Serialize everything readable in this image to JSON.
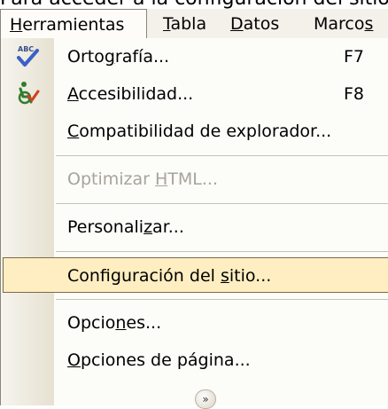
{
  "caption": "Para acceder a la configuración del sitio",
  "menubar": {
    "items": [
      {
        "pre": "",
        "u": "H",
        "post": "erramientas"
      },
      {
        "pre": "",
        "u": "T",
        "post": "abla"
      },
      {
        "pre": "",
        "u": "D",
        "post": "atos"
      },
      {
        "pre": "Marco",
        "u": "s",
        "post": ""
      }
    ]
  },
  "menu": {
    "ortografia": {
      "pre": "Orto",
      "u": "g",
      "post": "rafía...",
      "shortcut": "F7",
      "icon": "spellcheck-icon"
    },
    "accesibilidad": {
      "pre": "",
      "u": "A",
      "post": "ccesibilidad...",
      "shortcut": "F8",
      "icon": "accessibility-icon"
    },
    "compatibilidad": {
      "pre": "",
      "u": "C",
      "post": "ompatibilidad de explorador..."
    },
    "optimizar": {
      "pre": "Optimizar ",
      "u": "H",
      "post": "TML..."
    },
    "personalizar": {
      "pre": "Personali",
      "u": "z",
      "post": "ar..."
    },
    "configuracion": {
      "pre": "Configuración del ",
      "u": "s",
      "post": "itio..."
    },
    "opciones": {
      "pre": "Opcio",
      "u": "n",
      "post": "es..."
    },
    "opciones_pagina": {
      "pre": "",
      "u": "O",
      "post": "pciones de página..."
    },
    "expand_glyph": "»"
  }
}
